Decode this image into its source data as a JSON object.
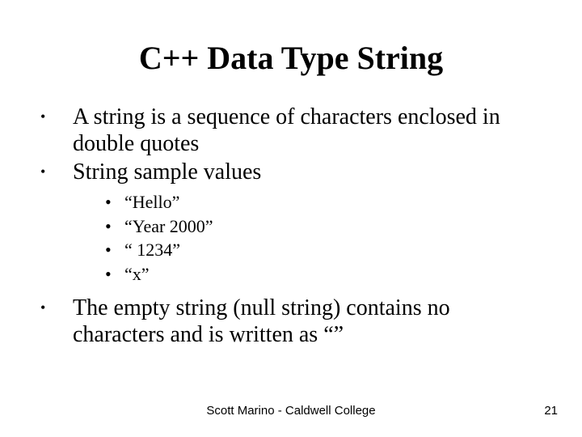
{
  "title": "C++ Data Type String",
  "bullets": {
    "b1": "A string is a sequence of characters enclosed in double quotes",
    "b2": "String sample values",
    "b3": "The empty string (null string) contains no characters and is written as “”"
  },
  "samples": {
    "s1": "“Hello”",
    "s2": "“Year 2000”",
    "s3": "“ 1234”",
    "s4": "“x”"
  },
  "footer": {
    "center": "Scott Marino - Caldwell College",
    "page": "21"
  }
}
